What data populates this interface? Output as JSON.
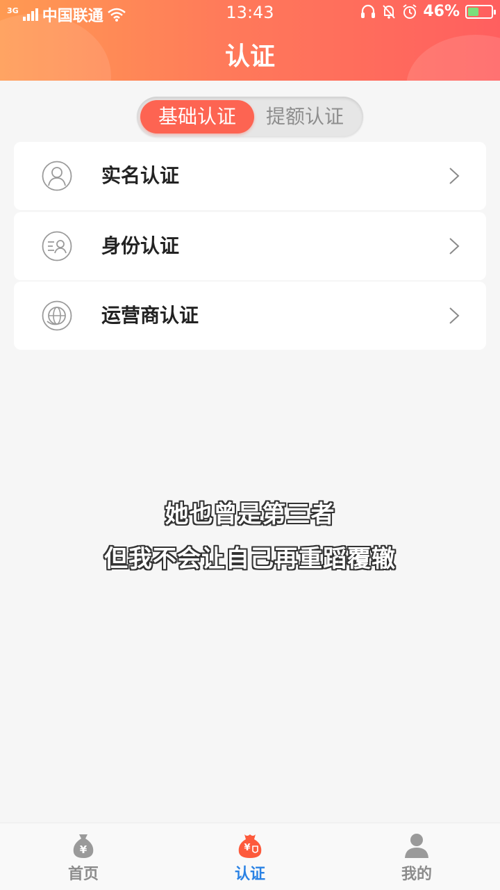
{
  "status_bar": {
    "network_type": "3G",
    "carrier": "中国联通",
    "time": "13:43",
    "battery_percent": "46%",
    "battery_level": 0.46,
    "icons": [
      "signal-icon",
      "wifi-icon",
      "headset-icon",
      "mute-icon",
      "alarm-icon",
      "battery-icon"
    ]
  },
  "header": {
    "title": "认证",
    "gradient_colors": [
      "#ff9a52",
      "#ff5f5f"
    ]
  },
  "segment": {
    "tabs": [
      {
        "label": "基础认证",
        "active": true
      },
      {
        "label": "提额认证",
        "active": false
      }
    ],
    "active_color": "#fd6452"
  },
  "verify_list": [
    {
      "label": "实名认证",
      "icon": "user-icon"
    },
    {
      "label": "身份认证",
      "icon": "id-card-icon"
    },
    {
      "label": "运营商认证",
      "icon": "globe-icon"
    }
  ],
  "subtitles": {
    "line1": "她也曾是第三者",
    "line2": "但我不会让自己再重蹈覆辙"
  },
  "bottom_nav": {
    "tabs": [
      {
        "label": "首页",
        "icon": "money-bag-icon",
        "active": false
      },
      {
        "label": "认证",
        "icon": "verify-bag-icon",
        "active": true
      },
      {
        "label": "我的",
        "icon": "person-icon",
        "active": false
      }
    ],
    "active_color": "#2a82e4"
  }
}
